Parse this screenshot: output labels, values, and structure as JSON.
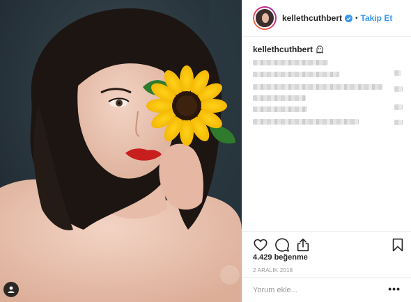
{
  "header": {
    "username": "kellethcuthbert",
    "separator": "•",
    "follow_label": "Takip Et"
  },
  "caption": {
    "username": "kellethcuthbert"
  },
  "actions": {
    "icons": [
      "heart-icon",
      "comment-icon",
      "share-icon",
      "bookmark-icon"
    ]
  },
  "likes_text": "4.429 beğenme",
  "date_text": "2 ARALIK 2018",
  "comment": {
    "placeholder": "Yorum ekle...",
    "more": "•••"
  },
  "colors": {
    "link": "#3897f0",
    "border": "#efefef",
    "muted": "#999999"
  }
}
